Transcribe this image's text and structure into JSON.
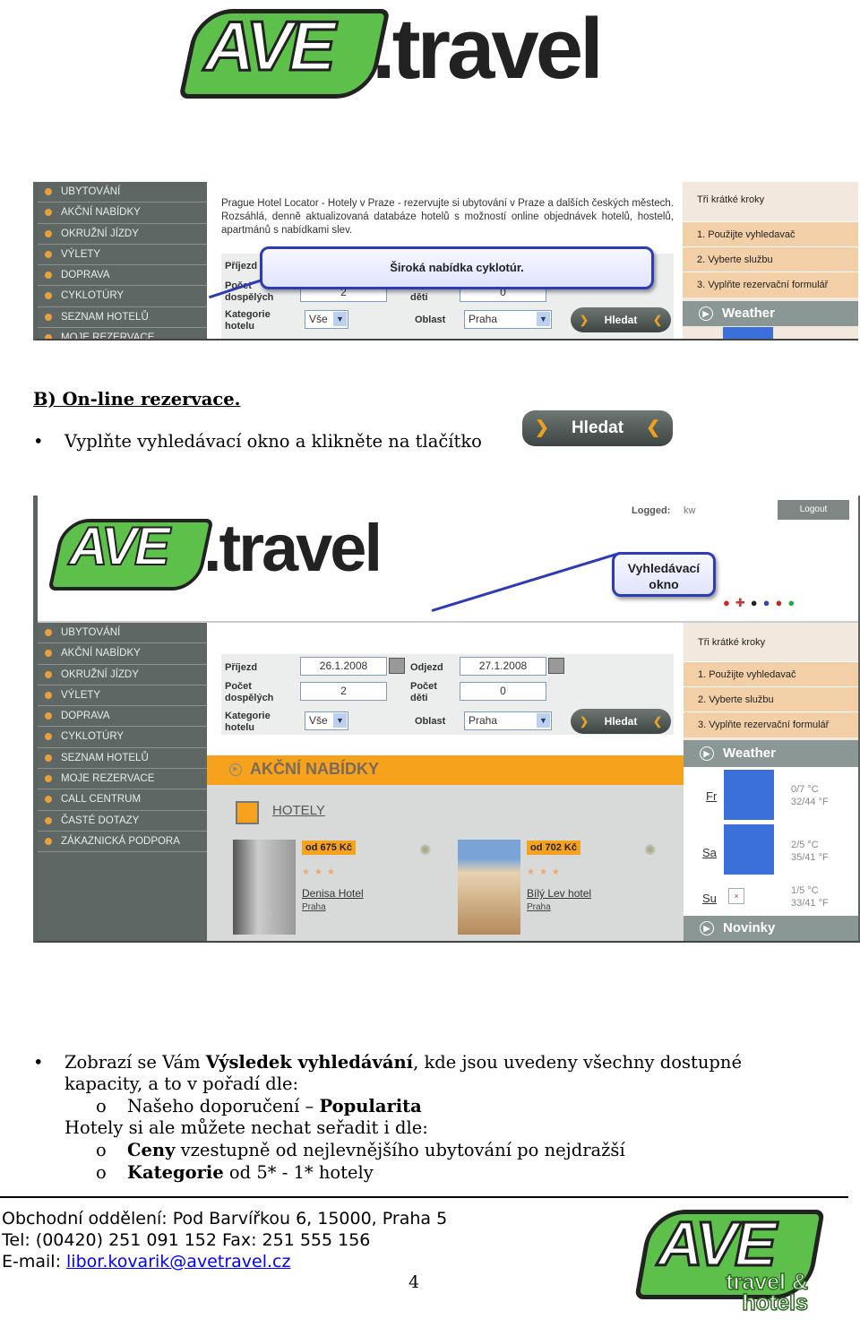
{
  "logo_top": {
    "text": "AVE.travel"
  },
  "screenshot1": {
    "sidebar": [
      "UBYTOVÁNÍ",
      "AKČNÍ NABÍDKY",
      "OKRUŽNÍ JÍZDY",
      "VÝLETY",
      "DOPRAVA",
      "CYKLOTÚRY",
      "SEZNAM HOTELŮ",
      "MOJE REZERVACE"
    ],
    "intro": "Prague Hotel Locator - Hotely v Praze - rezervujte si ubytování v Praze a dalších českých městech. Rozsáhlá, denně aktualizovaná databáze hotelů s možností online objednávek hotelů, hostelů, apartmánů s nabídkami slev.",
    "callout": "Široká nabídka cyklotúr.",
    "form": {
      "arrival": "Příjezd",
      "adults": "Počet dospělých",
      "adults_value": "2",
      "children": "Počet děti",
      "children_value": "0",
      "category": "Kategorie hotelu",
      "category_value": "Vše",
      "area": "Oblast",
      "area_value": "Praha",
      "search": "Hledat"
    },
    "steps_title": "Tři krátké kroky",
    "steps": [
      "1. Použijte vyhledavač",
      "2. Vyberte službu",
      "3. Vyplňte rezervační formulář"
    ],
    "weather": "Weather"
  },
  "section_title": "B) On-line rezervace.",
  "bullet1": "Vyplňte vyhledávací okno a klikněte na tlačítko",
  "search_button": "Hledat",
  "screenshot2": {
    "logged_label": "Logged:",
    "logged_user": "kw",
    "logout": "Logout",
    "callout": "Vyhledávací okno",
    "sidebar": [
      "UBYTOVÁNÍ",
      "AKČNÍ NABÍDKY",
      "OKRUŽNÍ JÍZDY",
      "VÝLETY",
      "DOPRAVA",
      "CYKLOTÚRY",
      "SEZNAM HOTELŮ",
      "MOJE REZERVACE",
      "CALL CENTRUM",
      "ČASTÉ DOTAZY",
      "ZÁKAZNICKÁ PODPORA"
    ],
    "form": {
      "arrival": "Příjezd",
      "arrival_value": "26.1.2008",
      "departure": "Odjezd",
      "departure_value": "27.1.2008",
      "adults": "Počet dospělých",
      "adults_value": "2",
      "children": "Počet děti",
      "children_value": "0",
      "category": "Kategorie hotelu",
      "category_value": "Vše",
      "area": "Oblast",
      "area_value": "Praha",
      "search": "Hledat"
    },
    "steps_title": "Tři krátké kroky",
    "steps": [
      "1. Použijte vyhledavač",
      "2. Vyberte službu",
      "3. Vyplňte rezervační formulář"
    ],
    "offers_title": "AKČNÍ NABÍDKY",
    "hotels_title": "HOTELY",
    "hotels": [
      {
        "price": "od 675 Kč",
        "stars": "★★★",
        "name": "Denisa Hotel",
        "city": "Praha"
      },
      {
        "price": "od 702 Kč",
        "stars": "★★★",
        "name": "Bílý Lev hotel",
        "city": "Praha"
      }
    ],
    "weather": "Weather",
    "forecast": [
      {
        "day": "Fr",
        "c": "0/7 °C",
        "f": "32/44 °F"
      },
      {
        "day": "Sa",
        "c": "2/5 °C",
        "f": "35/41 °F"
      },
      {
        "day": "Su",
        "c": "1/5 °C",
        "f": "33/41 °F"
      }
    ],
    "news": "Novinky"
  },
  "bullet2": {
    "pre": "Zobrazí se Vám ",
    "bold": "Výsledek vyhledávání",
    "post": ", kde jsou uvedeny všechny dostupné",
    "line2": "kapacity, a to v pořadí dle:"
  },
  "sub1": {
    "pre": "Našeho doporučení – ",
    "bold": "Popularita"
  },
  "line_sort": "Hotely si ale můžete nechat seřadit i dle:",
  "sub2": {
    "bold": "Ceny",
    "post": " vzestupně od nejlevnějšího ubytování po nejdražší"
  },
  "sub3": {
    "bold": "Kategorie",
    "post": " od 5* - 1* hotely"
  },
  "sub_bullet": "o",
  "footer": {
    "line1": "Obchodní oddělení: Pod Barvířkou 6, 15000, Praha 5",
    "line2": "Tel: (00420) 251 091 152 Fax: 251 555 156",
    "email_label": "E-mail: ",
    "email": "libor.kovarik@avetravel.cz",
    "page": "4",
    "logo_text": "travel & hotels"
  },
  "colors": {
    "green": "#5cc04a",
    "orange": "#f7a21c",
    "sidebar": "#5f6765",
    "callout_border": "#2d3bb5"
  }
}
